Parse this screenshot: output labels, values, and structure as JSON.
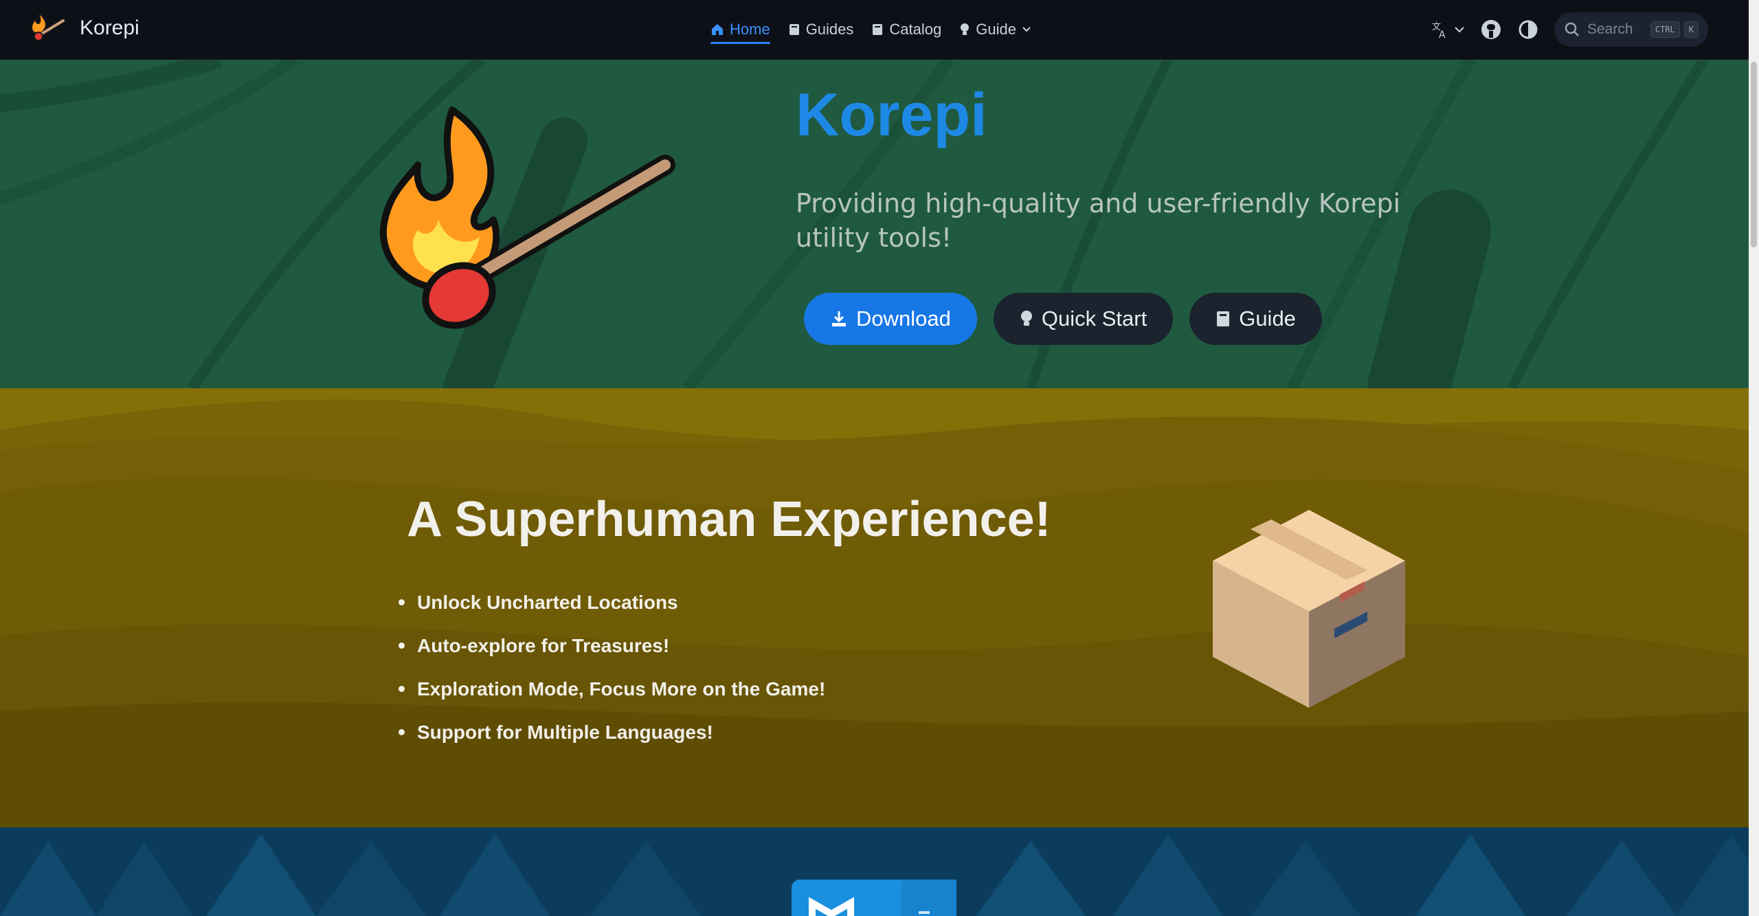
{
  "app": {
    "title": "Korepi"
  },
  "nav": {
    "links": [
      {
        "label": "Home",
        "icon": "home-icon",
        "active": true
      },
      {
        "label": "Guides",
        "icon": "book-icon",
        "active": false
      },
      {
        "label": "Catalog",
        "icon": "book-icon",
        "active": false
      },
      {
        "label": "Guide",
        "icon": "lightbulb-icon",
        "active": false,
        "dropdown": true
      }
    ],
    "search": {
      "placeholder": "Search",
      "shortcut_keys": [
        "CTRL",
        "K"
      ]
    }
  },
  "hero": {
    "title": "Korepi",
    "tagline": "Providing high-quality and user-friendly Korepi utility tools!",
    "actions": [
      {
        "label": "Download",
        "icon": "download-icon",
        "style": "primary"
      },
      {
        "label": "Quick Start",
        "icon": "lightbulb-icon",
        "style": "secondary"
      },
      {
        "label": "Guide",
        "icon": "book-icon",
        "style": "secondary"
      }
    ]
  },
  "feature": {
    "title": "A Superhuman Experience!",
    "items": [
      "Unlock Uncharted Locations",
      "Auto-explore for Treasures!",
      "Exploration Mode, Focus More on the Game!",
      "Support for Multiple Languages!"
    ]
  },
  "colors": {
    "accent": "#1e88e5",
    "hero_bg": "#1f5a40",
    "feature_bg": "#7a6407",
    "next_bg": "#0c3c5c",
    "navbar_bg": "#0d1117"
  }
}
